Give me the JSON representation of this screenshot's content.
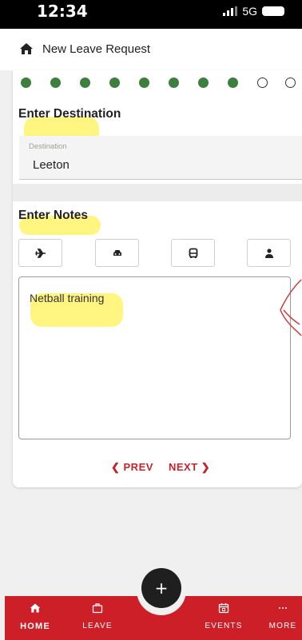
{
  "status_bar": {
    "time": "12:34",
    "network": "5G"
  },
  "header": {
    "title": "New Leave Request",
    "icon": "home-icon"
  },
  "progress": {
    "total_steps": 10,
    "completed_steps": 8
  },
  "destination": {
    "section_title": "Enter Destination",
    "field_label": "Destination",
    "value": "Leeton"
  },
  "notes": {
    "section_title": "Enter Notes",
    "transport_options": [
      {
        "icon": "airplane-icon"
      },
      {
        "icon": "car-icon"
      },
      {
        "icon": "bus-icon"
      },
      {
        "icon": "person-icon"
      }
    ],
    "text": "Netball training"
  },
  "pager": {
    "prev_label": "PREV",
    "next_label": "NEXT"
  },
  "bottom_nav": {
    "items": [
      {
        "label": "HOME",
        "icon": "home-icon",
        "active": true
      },
      {
        "label": "LEAVE",
        "icon": "briefcase-icon",
        "active": false
      },
      {
        "label": "EVENTS",
        "icon": "calendar-icon",
        "active": false
      },
      {
        "label": "MORE",
        "icon": "more-icon",
        "active": false
      }
    ],
    "fab_label": "+"
  },
  "colors": {
    "brand_red": "#cc1f27",
    "step_done": "#3e7e3e",
    "highlighter": "#fff03c"
  }
}
